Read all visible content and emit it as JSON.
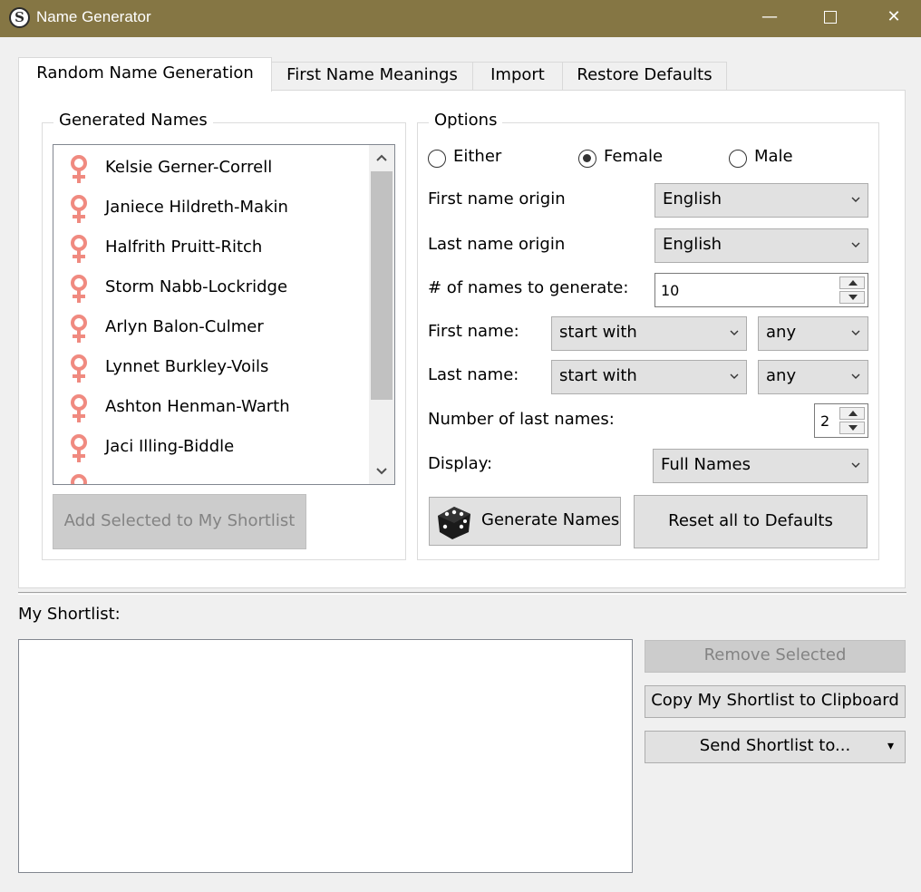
{
  "window": {
    "title": "Name Generator",
    "app_icon_letter": "S",
    "minimize": "—",
    "close": "✕"
  },
  "tabs": [
    {
      "label": "Random Name Generation",
      "active": true
    },
    {
      "label": "First Name Meanings",
      "active": false
    },
    {
      "label": "Import",
      "active": false
    },
    {
      "label": "Restore Defaults",
      "active": false
    }
  ],
  "generated": {
    "group_label": "Generated Names",
    "names": [
      "Kelsie Gerner-Correll",
      "Janiece Hildreth-Makin",
      "Halfrith Pruitt-Ritch",
      "Storm Nabb-Lockridge",
      "Arlyn Balon-Culmer",
      "Lynnet Burkley-Voils",
      "Ashton Henman-Warth",
      "Jaci Illing-Biddle"
    ],
    "add_button": "Add Selected to My Shortlist"
  },
  "options": {
    "group_label": "Options",
    "gender": {
      "either": "Either",
      "female": "Female",
      "male": "Male",
      "selected": "female"
    },
    "first_origin_label": "First name origin",
    "first_origin_value": "English",
    "last_origin_label": "Last name origin",
    "last_origin_value": "English",
    "count_label": "# of names to generate:",
    "count_value": "10",
    "first_name_label": "First name:",
    "first_name_mode": "start with",
    "first_name_letter": "any",
    "last_name_label": "Last name:",
    "last_name_mode": "start with",
    "last_name_letter": "any",
    "num_last_label": "Number of last names:",
    "num_last_value": "2",
    "display_label": "Display:",
    "display_value": "Full Names",
    "generate_button": "Generate Names",
    "reset_button": "Reset all to Defaults"
  },
  "shortlist": {
    "label": "My Shortlist:",
    "remove_button": "Remove Selected",
    "copy_button": "Copy My Shortlist to Clipboard",
    "send_button": "Send Shortlist to...",
    "send_arrow": "▾"
  },
  "colors": {
    "titlebar": "#857644",
    "female_icon": "#f08a80"
  }
}
